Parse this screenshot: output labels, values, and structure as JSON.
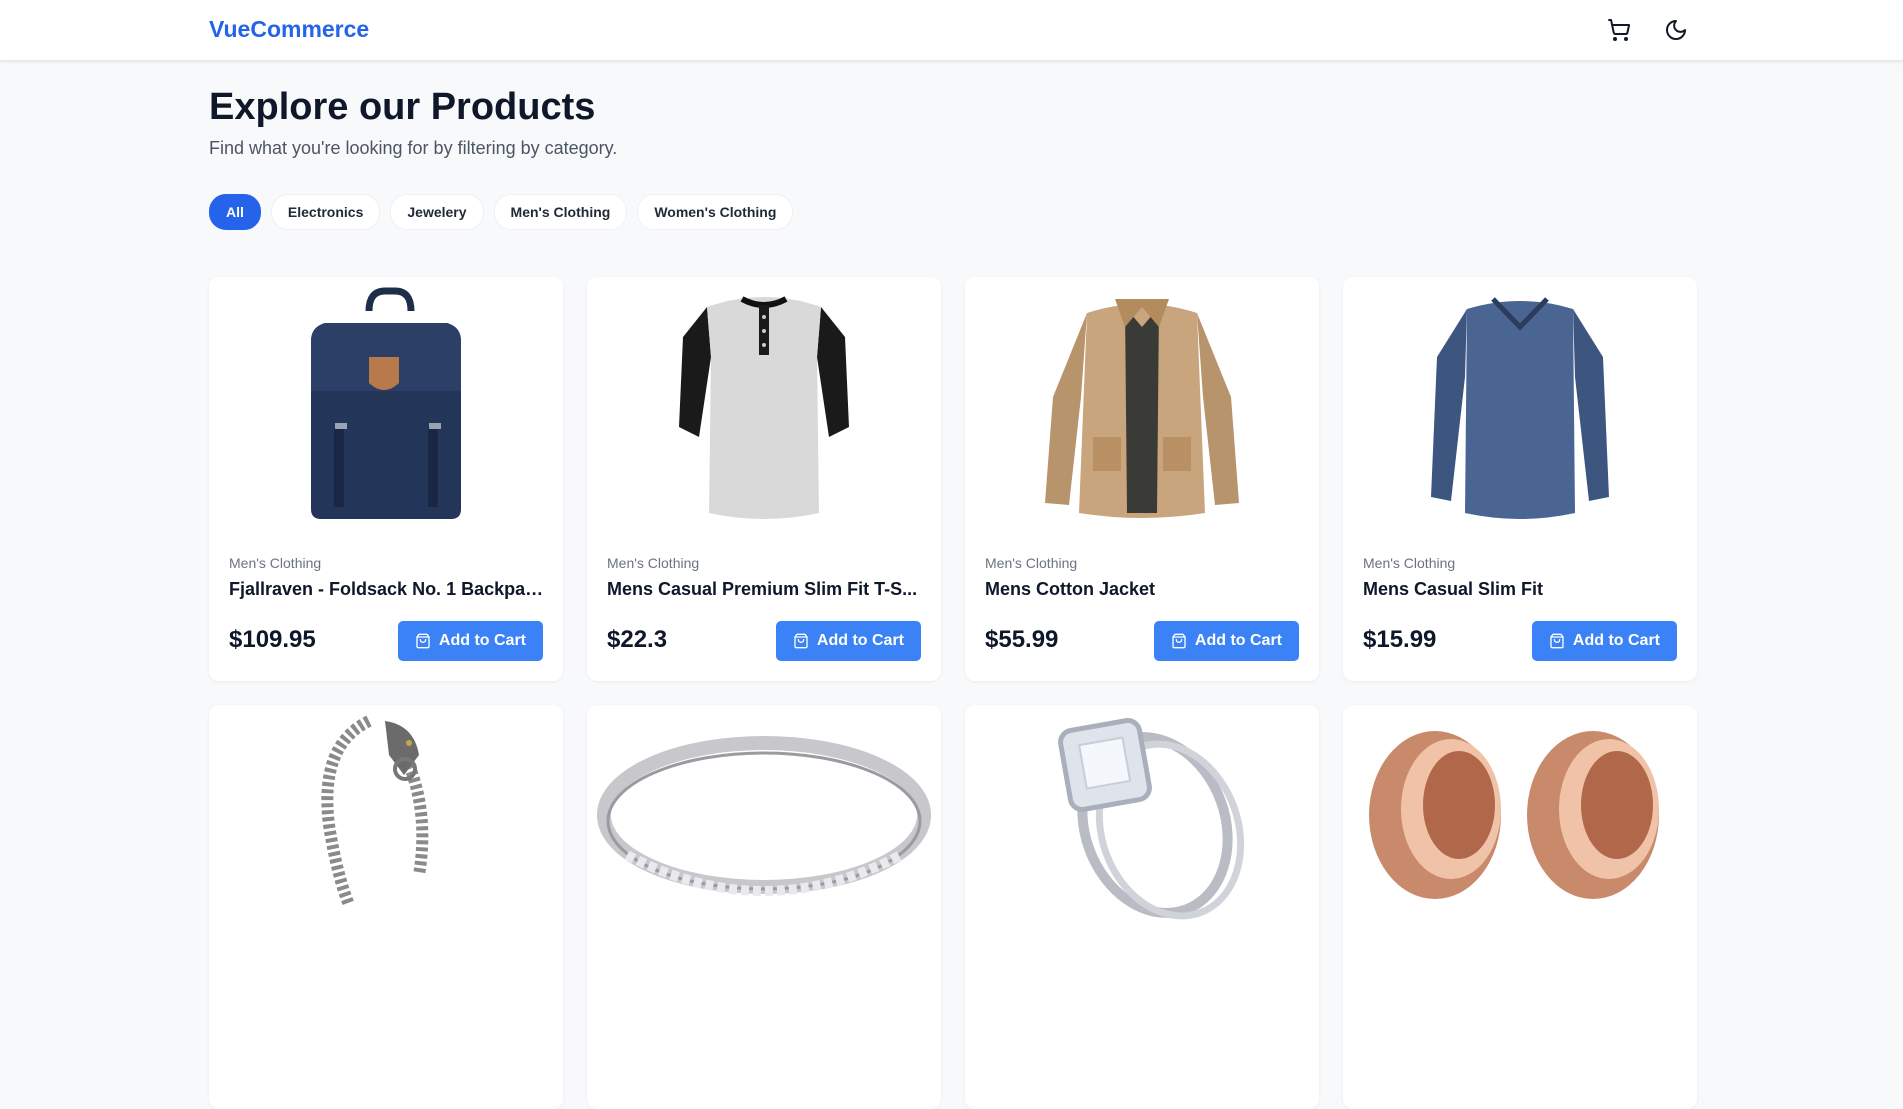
{
  "header": {
    "brand": "VueCommerce",
    "cart_icon": "shopping-cart-icon",
    "theme_icon": "moon-icon"
  },
  "hero": {
    "title": "Explore our Products",
    "subtitle": "Find what you're looking for by filtering by category."
  },
  "filters": [
    {
      "label": "All",
      "active": true
    },
    {
      "label": "Electronics",
      "active": false
    },
    {
      "label": "Jewelery",
      "active": false
    },
    {
      "label": "Men's Clothing",
      "active": false
    },
    {
      "label": "Women's Clothing",
      "active": false
    }
  ],
  "products": [
    {
      "category": "Men's Clothing",
      "title": "Fjallraven - Foldsack No. 1 Backpac...",
      "price": "$109.95",
      "button": "Add to Cart",
      "image": "navy-backpack"
    },
    {
      "category": "Men's Clothing",
      "title": "Mens Casual Premium Slim Fit T-S...",
      "price": "$22.3",
      "button": "Add to Cart",
      "image": "raglan-henley-shirt"
    },
    {
      "category": "Men's Clothing",
      "title": "Mens Cotton Jacket",
      "price": "$55.99",
      "button": "Add to Cart",
      "image": "khaki-jacket"
    },
    {
      "category": "Men's Clothing",
      "title": "Mens Casual Slim Fit",
      "price": "$15.99",
      "button": "Add to Cart",
      "image": "blue-long-sleeve-shirt"
    },
    {
      "category": "",
      "title": "",
      "price": "",
      "button": "",
      "image": "dragon-bracelet"
    },
    {
      "category": "",
      "title": "",
      "price": "",
      "button": "",
      "image": "silver-band-ring"
    },
    {
      "category": "",
      "title": "",
      "price": "",
      "button": "",
      "image": "diamond-engagement-ring"
    },
    {
      "category": "",
      "title": "",
      "price": "",
      "button": "",
      "image": "rose-gold-tunnel-plugs"
    }
  ],
  "colors": {
    "brand": "#2563eb",
    "button": "#3b82f6",
    "background": "#f8f9fb"
  }
}
